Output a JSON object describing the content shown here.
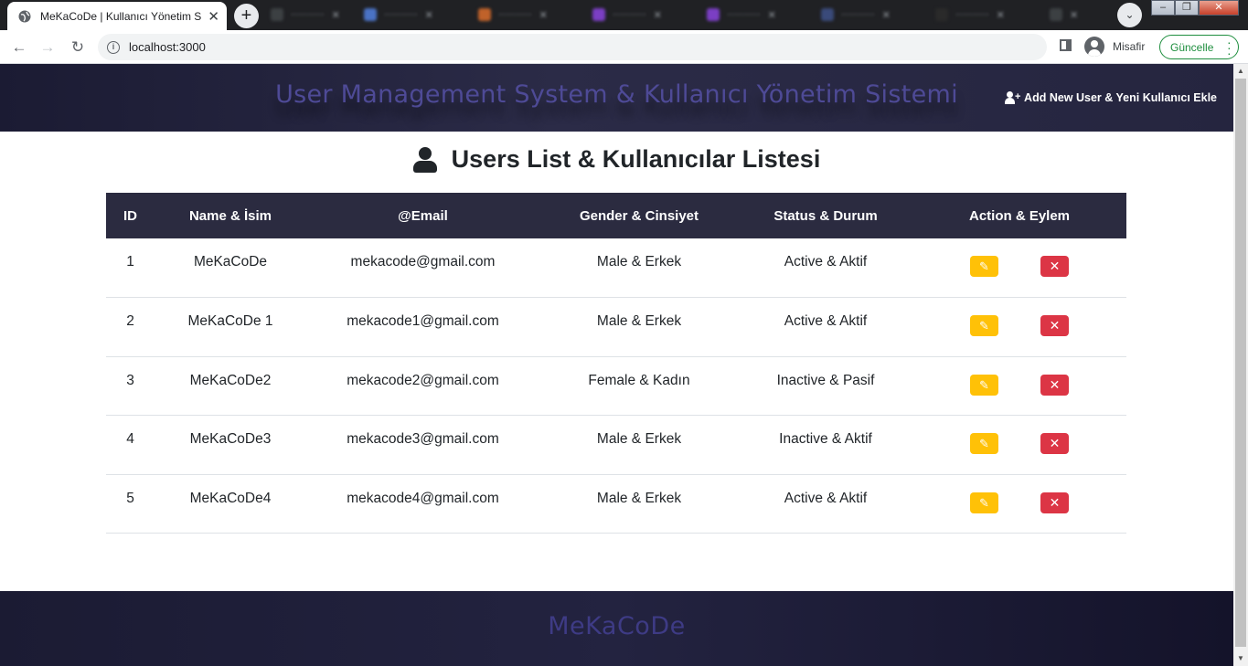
{
  "browser": {
    "tab_title": "MeKaCoDe | Kullanıcı Yönetim Si",
    "url": "localhost:3000",
    "profile_name": "Misafir",
    "update_label": "Güncelle"
  },
  "header": {
    "title": "User Management System & Kullanıcı Yönetim Sistemi",
    "add_user_label": "Add New User & Yeni Kullanıcı Ekle"
  },
  "page": {
    "heading": "Users List & Kullanıcılar Listesi"
  },
  "table": {
    "columns": [
      "ID",
      "Name & İsim",
      "@Email",
      "Gender & Cinsiyet",
      "Status & Durum",
      "Action & Eylem"
    ],
    "rows": [
      [
        "1",
        "MeKaCoDe",
        "mekacode@gmail.com",
        "Male & Erkek",
        "Active & Aktif"
      ],
      [
        "2",
        "MeKaCoDe 1",
        "mekacode1@gmail.com",
        "Male & Erkek",
        "Active & Aktif"
      ],
      [
        "3",
        "MeKaCoDe2",
        "mekacode2@gmail.com",
        "Female & Kadın",
        "Inactive & Pasif"
      ],
      [
        "4",
        "MeKaCoDe3",
        "mekacode3@gmail.com",
        "Male & Erkek",
        "Inactive & Aktif"
      ],
      [
        "5",
        "MeKaCoDe4",
        "mekacode4@gmail.com",
        "Male & Erkek",
        "Active & Aktif"
      ]
    ]
  },
  "footer": {
    "brand": "MeKaCoDe"
  },
  "icons": {
    "edit": "pencil-icon",
    "delete": "close-icon",
    "user": "user-icon",
    "add_user": "user-plus-icon"
  },
  "colors": {
    "header_bg": "#2b2b47",
    "title_text": "#4e4a96",
    "edit_button": "#ffc107",
    "delete_button": "#dc3545",
    "update_green": "#1e8e3e"
  }
}
